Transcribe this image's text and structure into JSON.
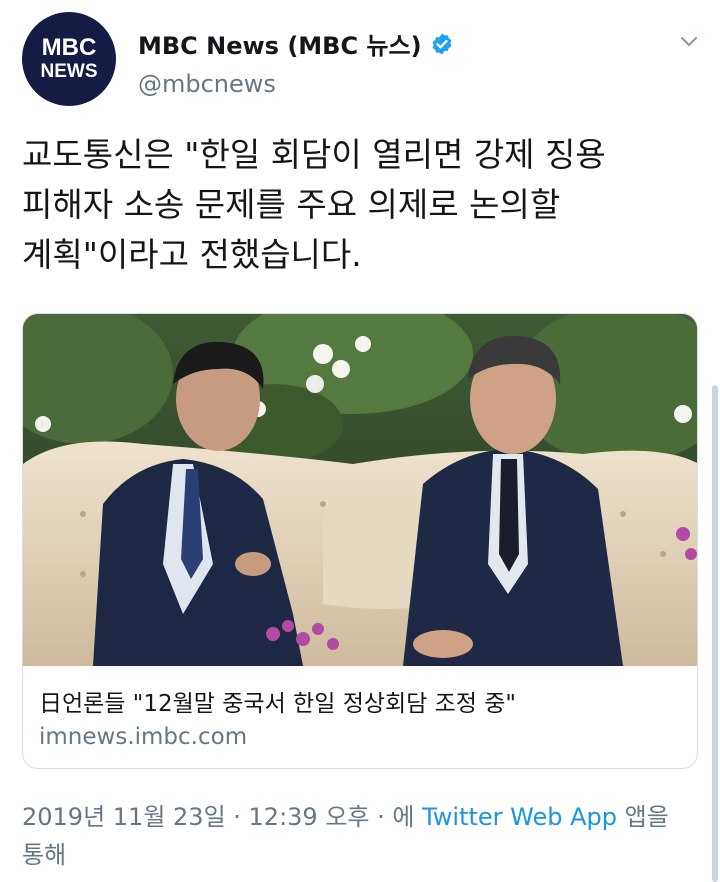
{
  "user": {
    "logo_top": "MBC",
    "logo_bottom": "NEWS",
    "display_name": "MBC News (MBC 뉴스)",
    "handle": "@mbcnews",
    "verified": true
  },
  "tweet": {
    "text_lines": [
      "교도통신은 \"한일 회담이 열리면 강제 징용",
      "피해자 소송 문제를 주요 의제로 논의할",
      "계획\"이라고 전했습니다."
    ]
  },
  "card": {
    "title": "日언론들 \"12월말 중국서 한일 정상회담 조정 중\"",
    "domain": "imnews.imbc.com"
  },
  "meta": {
    "date_time": "2019년 11월 23일 · 12:39 오후 · 에 ",
    "app": "Twitter Web App",
    "suffix": " 앱을",
    "suffix_line2": "통해"
  },
  "colors": {
    "avatar_bg": "#161b45",
    "verified_blue": "#1da1f2",
    "link_blue": "#1b95e0",
    "secondary_text": "#657786"
  },
  "icons": {
    "verified": "verified-badge-icon",
    "caret": "chevron-down-icon"
  }
}
